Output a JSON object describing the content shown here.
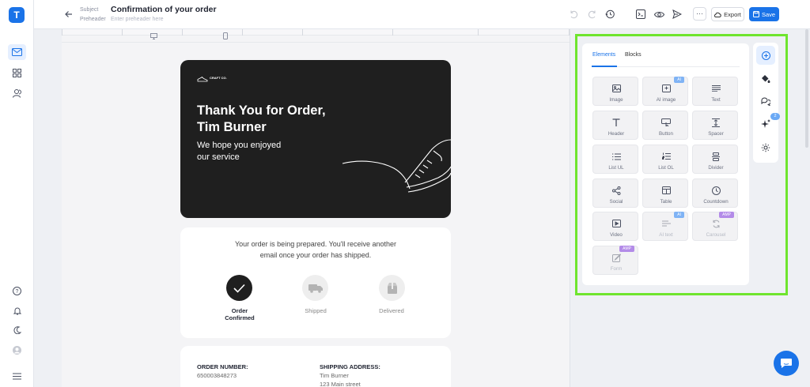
{
  "app": {
    "logo_letter": "T",
    "accent": "#1a73e8",
    "highlight": "#6fe52e"
  },
  "rail": {
    "top": [
      {
        "name": "mail-icon",
        "active": true
      },
      {
        "name": "blocks-icon"
      },
      {
        "name": "users-icon"
      }
    ],
    "bottom": [
      "help-icon",
      "bell-icon",
      "moon-icon",
      "avatar-icon",
      "menu-icon"
    ]
  },
  "header": {
    "subject_label": "Subject",
    "subject_value": "Confirmation of your order",
    "preheader_label": "Preheader",
    "preheader_placeholder": "Enter preheader here",
    "more_label": "···",
    "export_label": "Export",
    "save_label": "Save",
    "icons": [
      "undo-icon",
      "redo-icon",
      "history-icon",
      "code-icon",
      "preview-eye-icon",
      "send-icon"
    ]
  },
  "email": {
    "brand": "CRAFT CO.",
    "hero_title_line1": "Thank You for Order,",
    "hero_title_line2": "Tim Burner",
    "hero_sub_line1": "We hope you enjoyed",
    "hero_sub_line2": "our service",
    "status_line1": "Your order is being prepared. You'll receive another",
    "status_line2": "email once your order has shipped.",
    "steps": [
      {
        "label_line1": "Order",
        "label_line2": "Confirmed",
        "done": true
      },
      {
        "label_line1": "Shipped",
        "label_line2": "",
        "done": false
      },
      {
        "label_line1": "Delivered",
        "label_line2": "",
        "done": false
      }
    ],
    "order_number_label": "ORDER NUMBER:",
    "order_number_value": "650003848273",
    "shipping_label": "SHIPPING ADDRESS:",
    "shipping_name": "Tim Burner",
    "shipping_street": "123 Main street"
  },
  "panel": {
    "tabs": [
      {
        "label": "Elements",
        "active": true
      },
      {
        "label": "Blocks",
        "active": false
      }
    ],
    "tiles": [
      {
        "label": "Image",
        "icon": "image-icon"
      },
      {
        "label": "AI image",
        "icon": "ai-image-icon",
        "badge": "AI"
      },
      {
        "label": "Text",
        "icon": "text-icon"
      },
      {
        "label": "Header",
        "icon": "header-icon"
      },
      {
        "label": "Button",
        "icon": "button-icon"
      },
      {
        "label": "Spacer",
        "icon": "spacer-icon"
      },
      {
        "label": "List UL",
        "icon": "list-ul-icon"
      },
      {
        "label": "List OL",
        "icon": "list-ol-icon"
      },
      {
        "label": "Divider",
        "icon": "divider-icon"
      },
      {
        "label": "Social",
        "icon": "social-icon"
      },
      {
        "label": "Table",
        "icon": "table-icon"
      },
      {
        "label": "Countdown",
        "icon": "countdown-icon"
      },
      {
        "label": "Video",
        "icon": "video-icon"
      },
      {
        "label": "AI text",
        "icon": "ai-text-icon",
        "badge": "AI",
        "disabled": true
      },
      {
        "label": "Carousel",
        "icon": "carousel-icon",
        "badge": "AMP",
        "disabled": true
      },
      {
        "label": "Form",
        "icon": "form-icon",
        "badge": "AMP",
        "disabled": true
      }
    ],
    "badge_colors": {
      "AI": "#7fb3f5",
      "AMP": "#b38be8"
    }
  },
  "tools": {
    "items": [
      "add-circle-icon",
      "paint-bucket-icon",
      "comments-icon",
      "sparkle-icon",
      "settings-icon"
    ],
    "comments_count": "2"
  }
}
